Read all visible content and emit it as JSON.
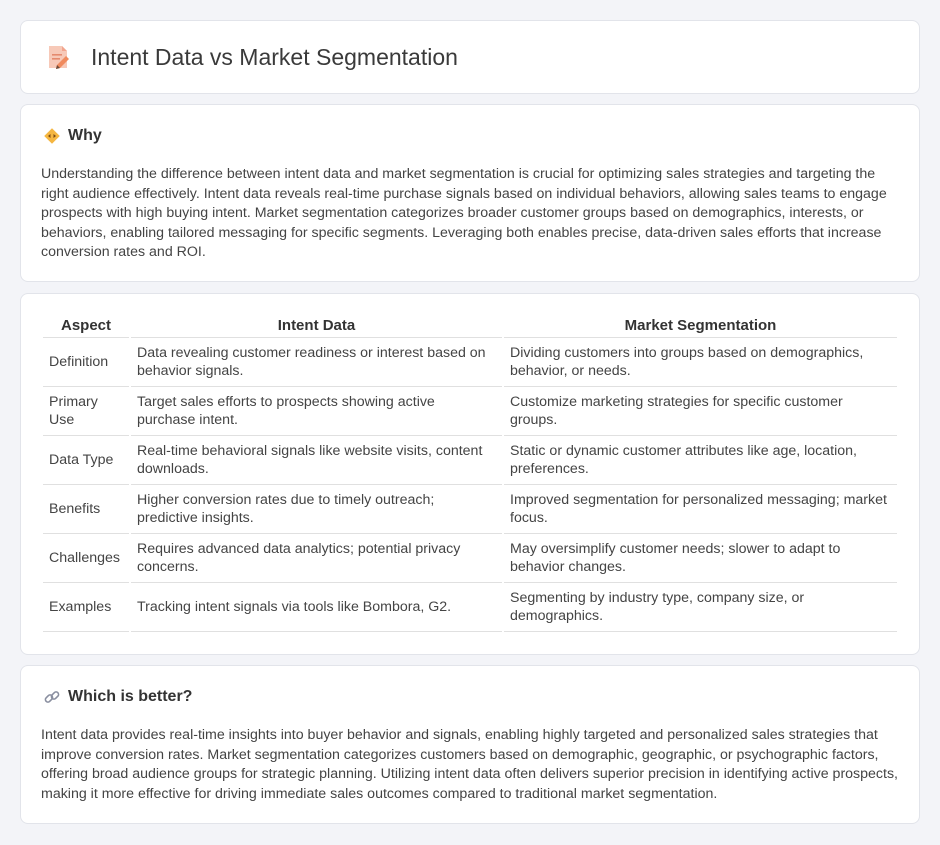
{
  "header": {
    "title": "Intent Data vs Market Segmentation",
    "icon": "document-pencil-icon"
  },
  "why": {
    "title": "Why",
    "icon": "diamond-arrows-icon",
    "text": "Understanding the difference between intent data and market segmentation is crucial for optimizing sales strategies and targeting the right audience effectively. Intent data reveals real-time purchase signals based on individual behaviors, allowing sales teams to engage prospects with high buying intent. Market segmentation categorizes broader customer groups based on demographics, interests, or behaviors, enabling tailored messaging for specific segments. Leveraging both enables precise, data-driven sales efforts that increase conversion rates and ROI."
  },
  "table": {
    "headers": [
      "Aspect",
      "Intent Data",
      "Market Segmentation"
    ],
    "rows": [
      [
        "Definition",
        "Data revealing customer readiness or interest based on behavior signals.",
        "Dividing customers into groups based on demographics, behavior, or needs."
      ],
      [
        "Primary Use",
        "Target sales efforts to prospects showing active purchase intent.",
        "Customize marketing strategies for specific customer groups."
      ],
      [
        "Data Type",
        "Real-time behavioral signals like website visits, content downloads.",
        "Static or dynamic customer attributes like age, location, preferences."
      ],
      [
        "Benefits",
        "Higher conversion rates due to timely outreach; predictive insights.",
        "Improved segmentation for personalized messaging; market focus."
      ],
      [
        "Challenges",
        "Requires advanced data analytics; potential privacy concerns.",
        "May oversimplify customer needs; slower to adapt to behavior changes."
      ],
      [
        "Examples",
        "Tracking intent signals via tools like Bombora, G2.",
        "Segmenting by industry type, company size, or demographics."
      ]
    ]
  },
  "better": {
    "title": "Which is better?",
    "icon": "link-icon",
    "text": "Intent data provides real-time insights into buyer behavior and signals, enabling highly targeted and personalized sales strategies that improve conversion rates. Market segmentation categorizes customers based on demographic, geographic, or psychographic factors, offering broad audience groups for strategic planning. Utilizing intent data often delivers superior precision in identifying active prospects, making it more effective for driving immediate sales outcomes compared to traditional market segmentation."
  }
}
